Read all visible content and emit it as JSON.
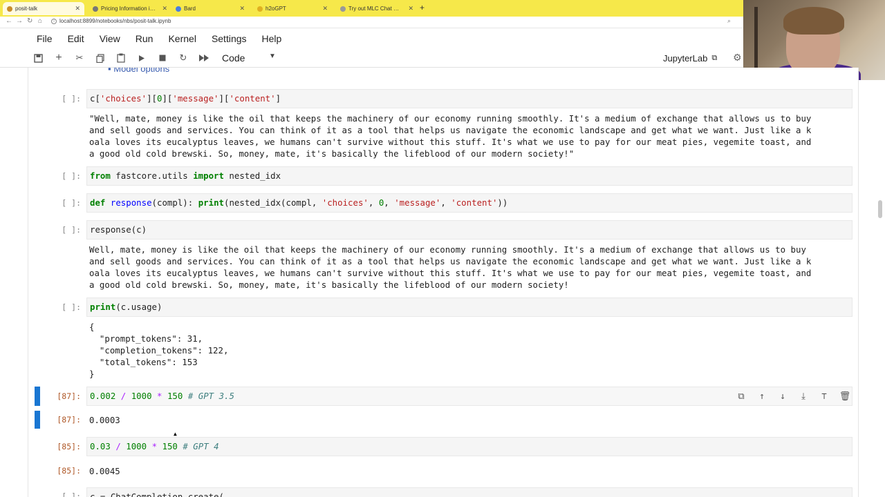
{
  "browser": {
    "tabs": [
      {
        "label": "posit-talk",
        "active": true
      },
      {
        "label": "Pricing Information in Markdown",
        "active": false
      },
      {
        "label": "Bard",
        "active": false
      },
      {
        "label": "h2oGPT",
        "active": false
      },
      {
        "label": "Try out MLC Chat — mlc-llm 0.",
        "active": false
      }
    ],
    "url": "localhost:8899/notebooks/nbs/posit-talk.ipynb"
  },
  "menubar": [
    "File",
    "Edit",
    "View",
    "Run",
    "Kernel",
    "Settings",
    "Help"
  ],
  "toolbar": {
    "cell_type": "Code",
    "jupyterlab_label": "JupyterLab",
    "icons": [
      "save-icon",
      "add-icon",
      "cut-icon",
      "copy-icon",
      "paste-icon",
      "run-icon",
      "stop-icon",
      "restart-icon",
      "fast-forward-icon"
    ]
  },
  "notebook": {
    "heading_fragment": "Model options",
    "cells": [
      {
        "prompt": "[ ]:",
        "code": "c['choices'][0]['message']['content']",
        "output": "\"Well, mate, money is like the oil that keeps the machinery of our economy running smoothly. It's a medium of exchange that allows us to buy\nand sell goods and services. You can think of it as a tool that helps us navigate the economic landscape and get what we want. Just like a k\noala loves its eucalyptus leaves, we humans can't survive without this stuff. It's what we use to pay for our meat pies, vegemite toast, and\na good old cold brewski. So, money, mate, it's basically the lifeblood of our modern society!\""
      },
      {
        "prompt": "[ ]:",
        "code": "from fastcore.utils import nested_idx"
      },
      {
        "prompt": "[ ]:",
        "code": "def response(compl): print(nested_idx(compl, 'choices', 0, 'message', 'content'))"
      },
      {
        "prompt": "[ ]:",
        "code": "response(c)",
        "output": "Well, mate, money is like the oil that keeps the machinery of our economy running smoothly. It's a medium of exchange that allows us to buy\nand sell goods and services. You can think of it as a tool that helps us navigate the economic landscape and get what we want. Just like a k\noala loves its eucalyptus leaves, we humans can't survive without this stuff. It's what we use to pay for our meat pies, vegemite toast, and\na good old cold brewski. So, money, mate, it's basically the lifeblood of our modern society!"
      },
      {
        "prompt": "[ ]:",
        "code": "print(c.usage)",
        "output": "{\n  \"prompt_tokens\": 31,\n  \"completion_tokens\": 122,\n  \"total_tokens\": 153\n}"
      },
      {
        "prompt": "[87]:",
        "code": "0.002 / 1000 * 150 # GPT 3.5",
        "out_prompt": "[87]:",
        "output": "0.0003"
      },
      {
        "prompt": "[85]:",
        "code": "0.03 / 1000 * 150 # GPT 4",
        "out_prompt": "[85]:",
        "output": "0.0045"
      },
      {
        "prompt": "[ ]:",
        "code": "c = ChatCompletion.create("
      }
    ]
  }
}
